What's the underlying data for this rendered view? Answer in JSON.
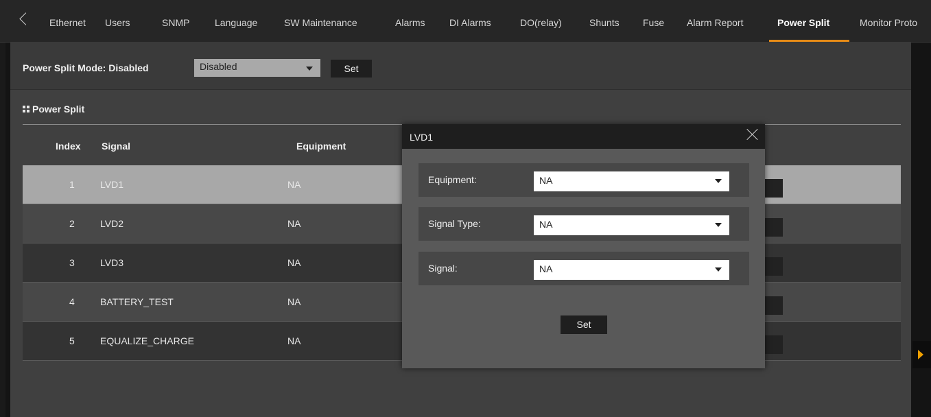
{
  "tabs": [
    {
      "label": "Ethernet",
      "active": false
    },
    {
      "label": "Users",
      "active": false
    },
    {
      "label": "SNMP",
      "active": false
    },
    {
      "label": "Language",
      "active": false
    },
    {
      "label": "SW Maintenance",
      "active": false
    },
    {
      "label": "Alarms",
      "active": false
    },
    {
      "label": "DI Alarms",
      "active": false
    },
    {
      "label": "DO(relay)",
      "active": false
    },
    {
      "label": "Shunts",
      "active": false
    },
    {
      "label": "Fuse",
      "active": false
    },
    {
      "label": "Alarm Report",
      "active": false
    },
    {
      "label": "Power Split",
      "active": true
    },
    {
      "label": "Monitor Proto",
      "active": false
    }
  ],
  "accent_color": "#e58a17",
  "mode": {
    "label": "Power Split Mode:  Disabled",
    "select_value": "Disabled",
    "set_label": "Set"
  },
  "section": {
    "title": "Power Split"
  },
  "table": {
    "headers": {
      "index": "Index",
      "signal": "Signal",
      "equipment": "Equipment"
    },
    "rows": [
      {
        "index": "1",
        "signal": "LVD1",
        "equipment": "NA",
        "selected": true
      },
      {
        "index": "2",
        "signal": "LVD2",
        "equipment": "NA"
      },
      {
        "index": "3",
        "signal": "LVD3",
        "equipment": "NA"
      },
      {
        "index": "4",
        "signal": "BATTERY_TEST",
        "equipment": "NA"
      },
      {
        "index": "5",
        "signal": "EQUALIZE_CHARGE",
        "equipment": "NA"
      }
    ]
  },
  "modal": {
    "title": "LVD1",
    "fields": [
      {
        "label": "Equipment:",
        "value": "NA"
      },
      {
        "label": "Signal Type:",
        "value": "NA"
      },
      {
        "label": "Signal:",
        "value": "NA"
      }
    ],
    "set_label": "Set"
  }
}
